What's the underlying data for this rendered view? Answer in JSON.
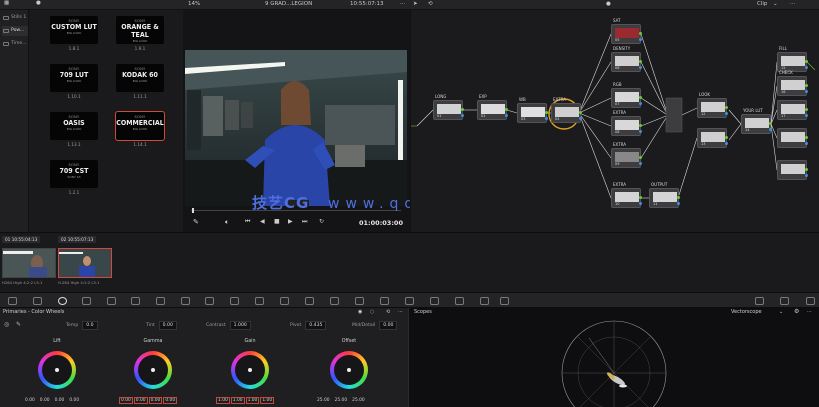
{
  "topbar": {
    "project_title": "9 GRAD...LEGION",
    "zoom": "14%",
    "timecode": "10:55:07:13",
    "clip_label": "Clip"
  },
  "leftnav": {
    "items": [
      "Stills 1",
      "Pow...",
      "Time..."
    ]
  },
  "gallery": {
    "brand": "SONY",
    "luts": [
      {
        "name": "CUSTOM LUT",
        "sub": "BIG LOOK",
        "caption": "1.8.1"
      },
      {
        "name": "ORANGE & TEAL",
        "sub": "BIG LOOK",
        "caption": "1.9.1"
      },
      {
        "name": "709 LUT",
        "sub": "BIG LOOK",
        "caption": "1.10.1"
      },
      {
        "name": "KODAK 60",
        "sub": "BIG LOOK",
        "caption": "1.11.1"
      },
      {
        "name": "OASIS",
        "sub": "BIG LOOK",
        "caption": "1.13.1"
      },
      {
        "name": "COMMERCIAL",
        "sub": "BIG LOOK",
        "caption": "1.14.1"
      },
      {
        "name": "709 CST",
        "sub": "SONY S3",
        "caption": "1.2.1"
      }
    ]
  },
  "viewer": {
    "timecode": "01:00:03:00"
  },
  "watermark": {
    "cn": "技艺CG",
    "url": "www.qdnxxfb.cn"
  },
  "nodes": {
    "labels": [
      "LONG",
      "EXP",
      "WB",
      "EXTRA",
      "SAT",
      "DENSITY",
      "RGB",
      "EXTRA",
      "EXTRA",
      "EXTRA",
      "OUTPUT",
      "LOOK",
      "YOUR LUT",
      "FILL",
      "CHECK"
    ],
    "numbers": [
      "01",
      "02",
      "03",
      "04",
      "05",
      "06",
      "07",
      "08",
      "09",
      "10",
      "11",
      "12",
      "13",
      "14",
      "15",
      "16",
      "17"
    ]
  },
  "timeline": {
    "clips": [
      {
        "index": "01",
        "tc": "10:55:04:13",
        "name": "H264 High 4:2:2 L5.1"
      },
      {
        "index": "02",
        "tc": "10:55:07:13",
        "name": "H.264 High 4:2:2 L5.1"
      }
    ]
  },
  "wheels": {
    "panel_title": "Primaries - Color Wheels",
    "params": [
      {
        "label": "Temp",
        "value": "0.0"
      },
      {
        "label": "Tint",
        "value": "0.00"
      },
      {
        "label": "Contrast",
        "value": "1.000"
      },
      {
        "label": "Pivot",
        "value": "0.435"
      },
      {
        "label": "Mid/Detail",
        "value": "0.00"
      }
    ],
    "wheels": [
      {
        "label": "Lift",
        "values": [
          "0.00",
          "0.00",
          "0.00",
          "0.00"
        ]
      },
      {
        "label": "Gamma",
        "values": [
          "0.00",
          "0.00",
          "0.00",
          "0.00"
        ]
      },
      {
        "label": "Gain",
        "values": [
          "1.00",
          "1.00",
          "1.00",
          "1.00"
        ]
      },
      {
        "label": "Offset",
        "values": [
          "25.00",
          "25.00",
          "25.00"
        ]
      }
    ]
  },
  "scopes": {
    "title": "Scopes",
    "mode": "Vectorscope"
  },
  "colors": {
    "accent_red": "#d04a3a",
    "node_orange": "#e0a020",
    "link_white": "#d8d8d8",
    "green_port": "#66cc33",
    "blue_port": "#3a8fd8"
  }
}
